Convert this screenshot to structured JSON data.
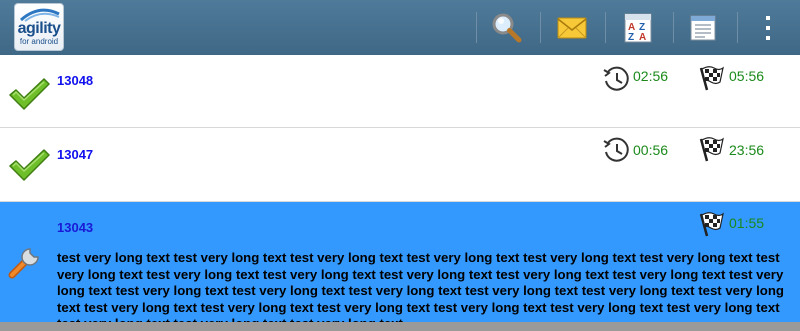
{
  "app": {
    "logo_main": "agility",
    "logo_sub": "for android"
  },
  "actionbar": {
    "actions": [
      {
        "name": "search",
        "icon": "magnifier-icon"
      },
      {
        "name": "messages",
        "icon": "envelope-icon"
      },
      {
        "name": "sort",
        "icon": "sort-az-icon"
      },
      {
        "name": "list",
        "icon": "list-icon"
      },
      {
        "name": "overflow",
        "icon": "overflow-menu-icon"
      }
    ]
  },
  "items": [
    {
      "id": "13048",
      "status_icon": "checkmark-icon",
      "elapsed": "02:56",
      "finish": "05:56",
      "description": "",
      "selected": false
    },
    {
      "id": "13047",
      "status_icon": "checkmark-icon",
      "elapsed": "00:56",
      "finish": "23:56",
      "description": "",
      "selected": false
    },
    {
      "id": "13043",
      "status_icon": "wrench-icon",
      "elapsed": "",
      "finish": "01:55",
      "description": "test very long text test very long text test very long text test very long text test very long text test very long text test very long text test very long text test very long text test very long text test very long text test very long text test very long text test very long text test very long text test very long text test very long text test very long text test very long text test very long text test very long text test very long text test very long text test very long text test very long text test very long text test very long text test very long text",
      "selected": true
    }
  ],
  "colors": {
    "actionbar": "#3f6886",
    "selected_row": "#3399ff",
    "id_text": "#1010ee",
    "time_text": "#1b8a1b"
  }
}
